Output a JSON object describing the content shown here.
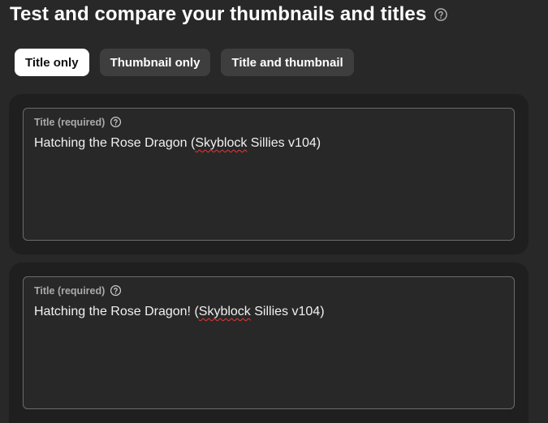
{
  "header": {
    "title": "Test and compare your thumbnails and titles",
    "help_icon": "help-circle-icon"
  },
  "modes": {
    "items": [
      {
        "label": "Title only",
        "selected": true
      },
      {
        "label": "Thumbnail only",
        "selected": false
      },
      {
        "label": "Title and thumbnail",
        "selected": false
      }
    ]
  },
  "titles": [
    {
      "label": "Title (required)",
      "help_icon": "help-circle-icon",
      "value_before": "Hatching the Rose Dragon (",
      "value_misspelled": "Skyblock",
      "value_after": " Sillies v104)"
    },
    {
      "label": "Title (required)",
      "help_icon": "help-circle-icon",
      "value_before": "Hatching the Rose Dragon! (",
      "value_misspelled": "Skyblock",
      "value_after": " Sillies v104)"
    }
  ],
  "colors": {
    "background": "#282828",
    "card": "#1f1f1f",
    "chip_selected": "#ffffff",
    "chip": "#3e3e3e",
    "spellcheck": "#e53935"
  }
}
